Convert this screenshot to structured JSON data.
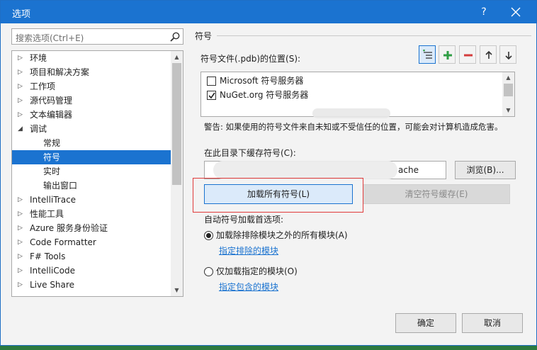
{
  "window": {
    "title": "选项",
    "help": "?"
  },
  "search": {
    "placeholder": "搜索选项(Ctrl+E)"
  },
  "tree": {
    "items": [
      {
        "label": "环境",
        "arrow": "▷",
        "selected": false
      },
      {
        "label": "项目和解决方案",
        "arrow": "▷",
        "selected": false
      },
      {
        "label": "工作项",
        "arrow": "▷",
        "selected": false
      },
      {
        "label": "源代码管理",
        "arrow": "▷",
        "selected": false
      },
      {
        "label": "文本编辑器",
        "arrow": "▷",
        "selected": false
      },
      {
        "label": "调试",
        "arrow": "◢",
        "selected": false
      },
      {
        "label": "常规",
        "arrow": "",
        "selected": false
      },
      {
        "label": "符号",
        "arrow": "",
        "selected": true
      },
      {
        "label": "实时",
        "arrow": "",
        "selected": false
      },
      {
        "label": "输出窗口",
        "arrow": "",
        "selected": false
      },
      {
        "label": "IntelliTrace",
        "arrow": "▷",
        "selected": false
      },
      {
        "label": "性能工具",
        "arrow": "▷",
        "selected": false
      },
      {
        "label": "Azure 服务身份验证",
        "arrow": "▷",
        "selected": false
      },
      {
        "label": "Code Formatter",
        "arrow": "▷",
        "selected": false
      },
      {
        "label": "F# Tools",
        "arrow": "▷",
        "selected": false
      },
      {
        "label": "IntelliCode",
        "arrow": "▷",
        "selected": false
      },
      {
        "label": "Live Share",
        "arrow": "▷",
        "selected": false
      }
    ]
  },
  "symbols": {
    "section_title": "符号",
    "locations_label": "符号文件(.pdb)的位置(S):",
    "servers": [
      {
        "label": "Microsoft 符号服务器",
        "checked": false
      },
      {
        "label": "NuGet.org 符号服务器",
        "checked": true
      }
    ],
    "warning": "警告: 如果使用的符号文件来自未知或不受信任的位置，可能会对计算机造成危害。",
    "cache_label": "在此目录下缓存符号(C):",
    "cache_value": "ache",
    "browse": "浏览(B)...",
    "load_all": "加载所有符号(L)",
    "clear_cache": "清空符号缓存(E)",
    "auto_load_label": "自动符号加载首选项:",
    "option_all": "加载除排除模块之外的所有模块(A)",
    "link_exclude": "指定排除的模块",
    "option_only": "仅加载指定的模块(O)",
    "link_include": "指定包含的模块"
  },
  "footer": {
    "ok": "确定",
    "cancel": "取消"
  },
  "colors": {
    "accent": "#1b73d0",
    "highlight_border": "#e03a3a",
    "add_green": "#2f9e44",
    "remove_red": "#d43c3c"
  },
  "icons": {
    "toolbar": [
      "new-location-icon",
      "add-icon",
      "remove-icon",
      "move-up-icon",
      "move-down-icon"
    ]
  }
}
